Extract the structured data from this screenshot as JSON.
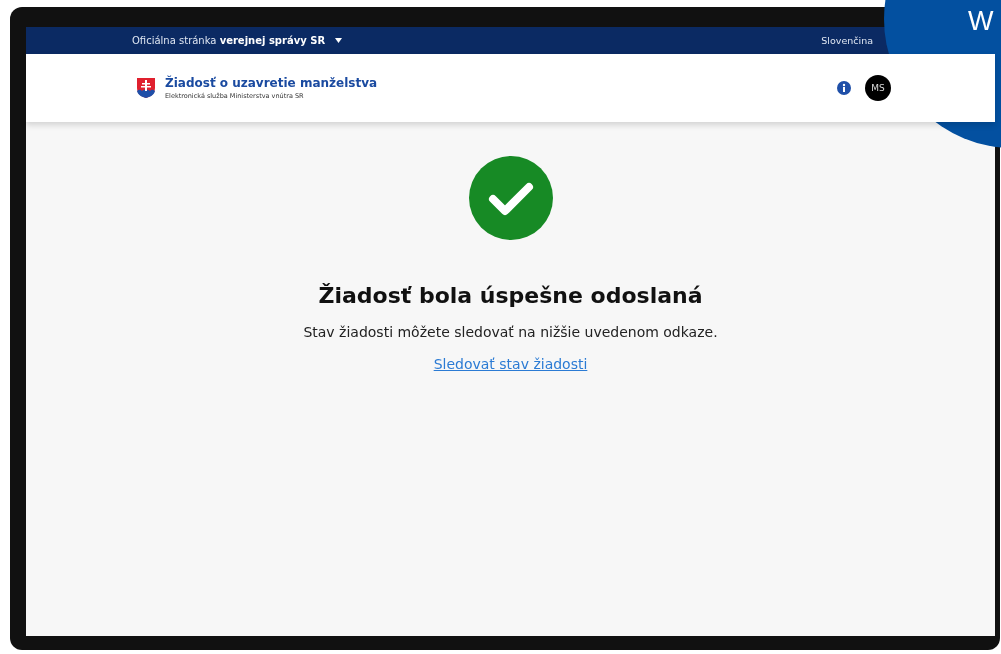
{
  "top_bar": {
    "label": "Oficiálna stránka **verejnej správy SR**",
    "language": "Slovenčina"
  },
  "header": {
    "title": "Žiadosť o uzavretie manželstva",
    "subtitle": "Elektronická služba Ministerstva vnútra SR",
    "avatar": "MS"
  },
  "confirmation": {
    "title": "Žiadosť bola úspešne odoslaná",
    "message": "Stav žiadosti môžete sledovať na nižšie uvedenom odkaze.",
    "link": "Sledovať stav žiadosti"
  },
  "corner_badge": {
    "text": "W"
  }
}
